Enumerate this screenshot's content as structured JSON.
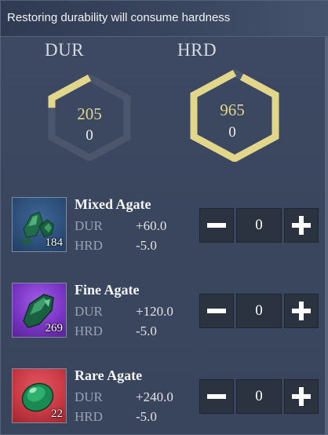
{
  "header": {
    "text": "Restoring durability will consume hardness"
  },
  "stats": {
    "dur": {
      "title": "DUR",
      "value": "205",
      "sub": "0",
      "fill_fraction": 0.21,
      "ring_color": "#e2d68a",
      "track_color": "#4b566c",
      "value_color": "#e2d68a"
    },
    "hrd": {
      "title": "HRD",
      "value": "965",
      "sub": "0",
      "fill_fraction": 0.97,
      "ring_color": "#e2d68a",
      "track_color": "#4b566c",
      "value_color": "#e2d68a"
    }
  },
  "items": [
    {
      "name": "Mixed Agate",
      "count": "184",
      "dur_label": "DUR",
      "dur_value": "+60.0",
      "hrd_label": "HRD",
      "hrd_value": "-5.0",
      "qty": "0",
      "rarity_color": "#2d4f7a",
      "icon": "mixed-agate-icon"
    },
    {
      "name": "Fine Agate",
      "count": "269",
      "dur_label": "DUR",
      "dur_value": "+120.0",
      "hrd_label": "HRD",
      "hrd_value": "-5.0",
      "qty": "0",
      "rarity_color": "#7a36c4",
      "icon": "fine-agate-icon"
    },
    {
      "name": "Rare Agate",
      "count": "22",
      "dur_label": "DUR",
      "dur_value": "+240.0",
      "hrd_label": "HRD",
      "hrd_value": "-5.0",
      "qty": "0",
      "rarity_color": "#c93a44",
      "icon": "rare-agate-icon"
    }
  ]
}
